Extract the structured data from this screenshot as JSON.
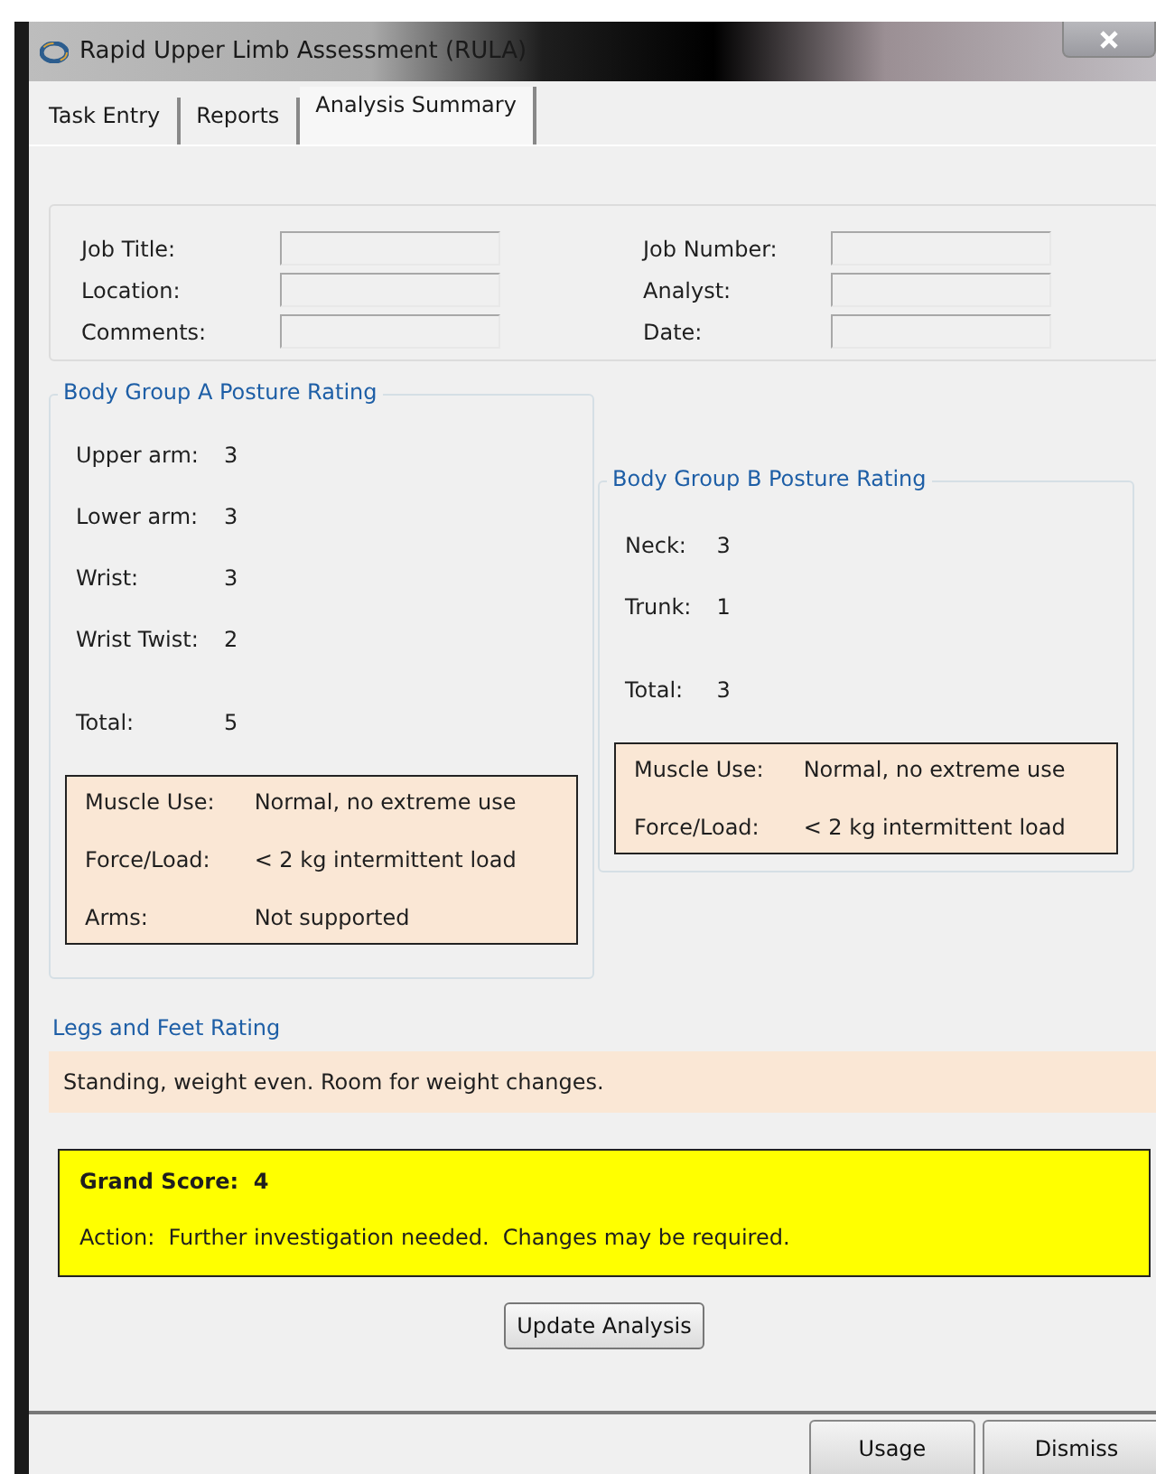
{
  "window": {
    "title": "Rapid Upper Limb Assessment (RULA)"
  },
  "tabs": [
    {
      "label": "Task Entry",
      "selected": false
    },
    {
      "label": "Reports",
      "selected": false
    },
    {
      "label": "Analysis Summary",
      "selected": true
    }
  ],
  "job_fields": {
    "left": [
      {
        "label": "Job Title:"
      },
      {
        "label": "Location:"
      },
      {
        "label": "Comments:"
      }
    ],
    "right": [
      {
        "label": "Job Number:"
      },
      {
        "label": "Analyst:"
      },
      {
        "label": "Date:"
      }
    ]
  },
  "body_group_a": {
    "title": "Body Group A Posture Rating",
    "ratings": [
      {
        "label": "Upper arm:",
        "value": "3"
      },
      {
        "label": "Lower arm:",
        "value": "3"
      },
      {
        "label": "Wrist:",
        "value": "3"
      },
      {
        "label": "Wrist Twist:",
        "value": "2"
      }
    ],
    "total": {
      "label": "Total:",
      "value": "5"
    },
    "factors": [
      {
        "label": "Muscle Use:",
        "value": "Normal, no extreme use"
      },
      {
        "label": "Force/Load:",
        "value": "< 2 kg intermittent load"
      },
      {
        "label": "Arms:",
        "value": "Not supported"
      }
    ]
  },
  "body_group_b": {
    "title": "Body Group B Posture Rating",
    "ratings": [
      {
        "label": "Neck:",
        "value": "3"
      },
      {
        "label": "Trunk:",
        "value": "1"
      }
    ],
    "total": {
      "label": "Total:",
      "value": "3"
    },
    "factors": [
      {
        "label": "Muscle Use:",
        "value": "Normal, no extreme use"
      },
      {
        "label": "Force/Load:",
        "value": "< 2 kg intermittent load"
      }
    ]
  },
  "legs_and_feet": {
    "title": "Legs and Feet Rating",
    "text": "Standing, weight even.  Room for weight changes."
  },
  "grand_score": {
    "label": "Grand Score:",
    "value": "4",
    "action": "Action:  Further investigation needed.  Changes may be required."
  },
  "update_button": "Update Analysis",
  "footer_buttons": [
    "Usage",
    "Dismiss"
  ]
}
